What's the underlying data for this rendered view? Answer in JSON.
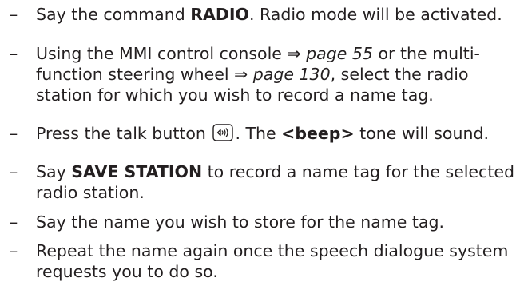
{
  "bullet": "–",
  "steps": [
    {
      "l1a": "Say the command ",
      "l1b": "RADIO",
      "l1c": ". Radio mode will be activated."
    },
    {
      "l1a": "Using the MMI control console ",
      "l1b": "⇒",
      "l1c": " ",
      "l1d": "page 55",
      "l1e": " or the multi-",
      "l2a": "function steering wheel ",
      "l2b": "⇒",
      "l2c": " ",
      "l2d": "page 130",
      "l2e": ", select the radio",
      "l3": "station for which you wish to record a name tag."
    },
    {
      "l1a": "Press the talk button ",
      "l1b": ". The ",
      "l1c": "<beep>",
      "l1d": " tone will sound."
    },
    {
      "l1a": "Say ",
      "l1b": "SAVE STATION",
      "l1c": " to record a name tag for the selected",
      "l2": "radio station."
    },
    {
      "l1": "Say the name you wish to store for the name tag."
    },
    {
      "l1": "Repeat the name again once the speech dialogue system",
      "l2": "requests you to do so."
    }
  ]
}
